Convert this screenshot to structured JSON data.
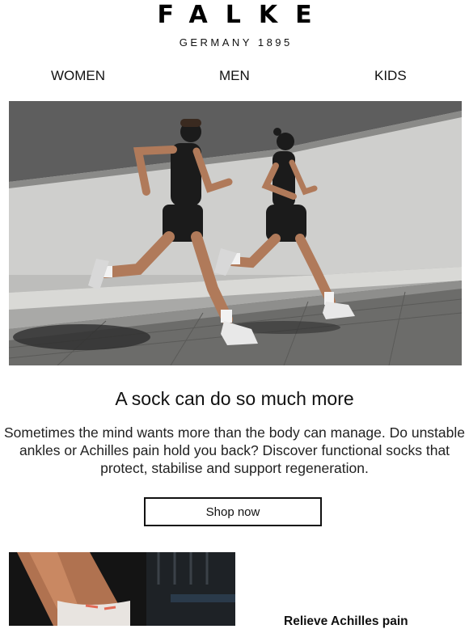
{
  "brand": {
    "logo": "FALKE",
    "tagline": "GERMANY 1895"
  },
  "nav": {
    "items": [
      {
        "label": "WOMEN"
      },
      {
        "label": "MEN"
      },
      {
        "label": "KIDS"
      }
    ]
  },
  "hero": {
    "headline": "A sock can do so much more",
    "body": "Sometimes the mind wants more than the body can manage. Do unstable ankles or Achilles pain hold you back? Discover functional socks that protect, stabilise and support regeneration.",
    "cta_label": "Shop now"
  },
  "product": {
    "title": "Relieve Achilles pain"
  }
}
